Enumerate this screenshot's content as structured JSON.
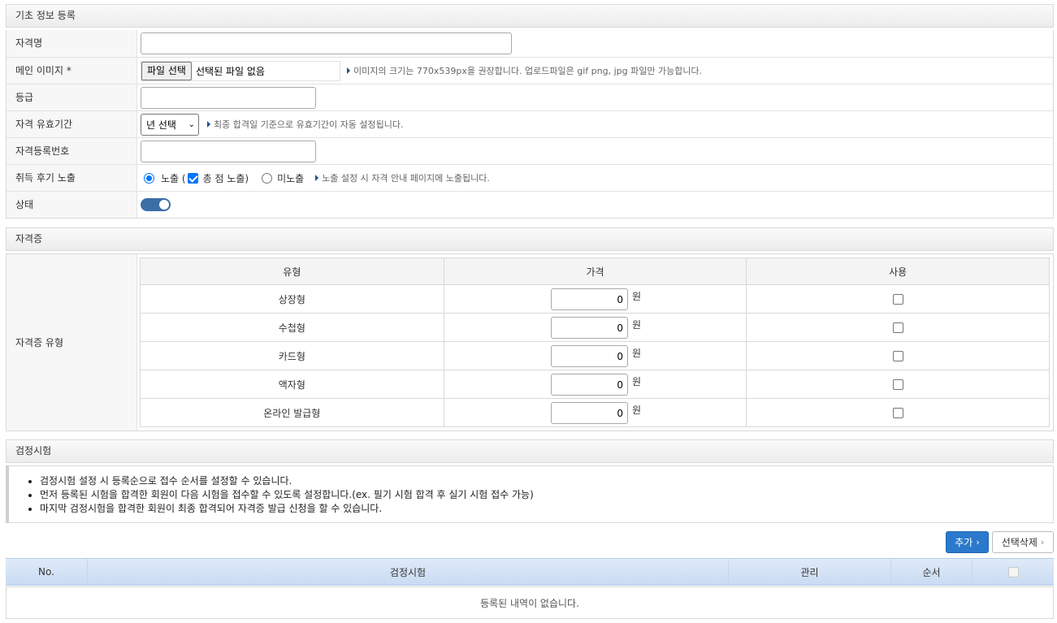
{
  "basic": {
    "header": "기초 정보 등록",
    "rows": {
      "name_label": "자격명",
      "image_label": "메인 이미지 *",
      "file_button": "파일 선택",
      "file_status": "선택된 파일 없음",
      "image_hint": "이미지의 크기는 770x539px을 권장합니다. 업로드파일은 gif png, jpg 파일만 가능합니다.",
      "grade_label": "등급",
      "validity_label": "자격 유효기간",
      "validity_select": "년 선택",
      "validity_hint": "최종 합격일 기준으로 유효기간이 자동 설정됩니다.",
      "regno_label": "자격등록번호",
      "review_label": "취득 후기 노출",
      "review_show": "노출 (",
      "review_score": "총 점 노출)",
      "review_hide": "미노출",
      "review_hint": "노출 설정 시 자격 안내 페이지에 노출됩니다.",
      "status_label": "상태"
    }
  },
  "cert": {
    "header": "자격증",
    "type_label": "자격증 유형",
    "columns": [
      "유형",
      "가격",
      "사용"
    ],
    "currency": "원",
    "rows": [
      {
        "type": "상장형",
        "price": "0"
      },
      {
        "type": "수첩형",
        "price": "0"
      },
      {
        "type": "카드형",
        "price": "0"
      },
      {
        "type": "액자형",
        "price": "0"
      },
      {
        "type": "온라인 발급형",
        "price": "0"
      }
    ]
  },
  "exam": {
    "header": "검정시험",
    "notices": [
      "검정시험 설정 시 등록순으로 접수 순서를 설정할 수 있습니다.",
      "먼저 등록된 시험을 합격한 회원이 다음 시험을 접수할 수 있도록 설정합니다.(ex. 필기 시험 합격 후 실기 시험 접수 가능)",
      "마지막 검정시험을 합격한 회원이 최종 합격되어 자격증 발급 신청을 할 수 있습니다."
    ],
    "add_button": "추가",
    "delete_button": "선택삭제",
    "columns": [
      "No.",
      "검정시험",
      "관리",
      "순서"
    ],
    "empty_text": "등록된 내역이 없습니다."
  },
  "colors": {
    "accent": "#2a79cc",
    "toggle": "#3c6ea6",
    "table_head": "#c9dbf3"
  }
}
